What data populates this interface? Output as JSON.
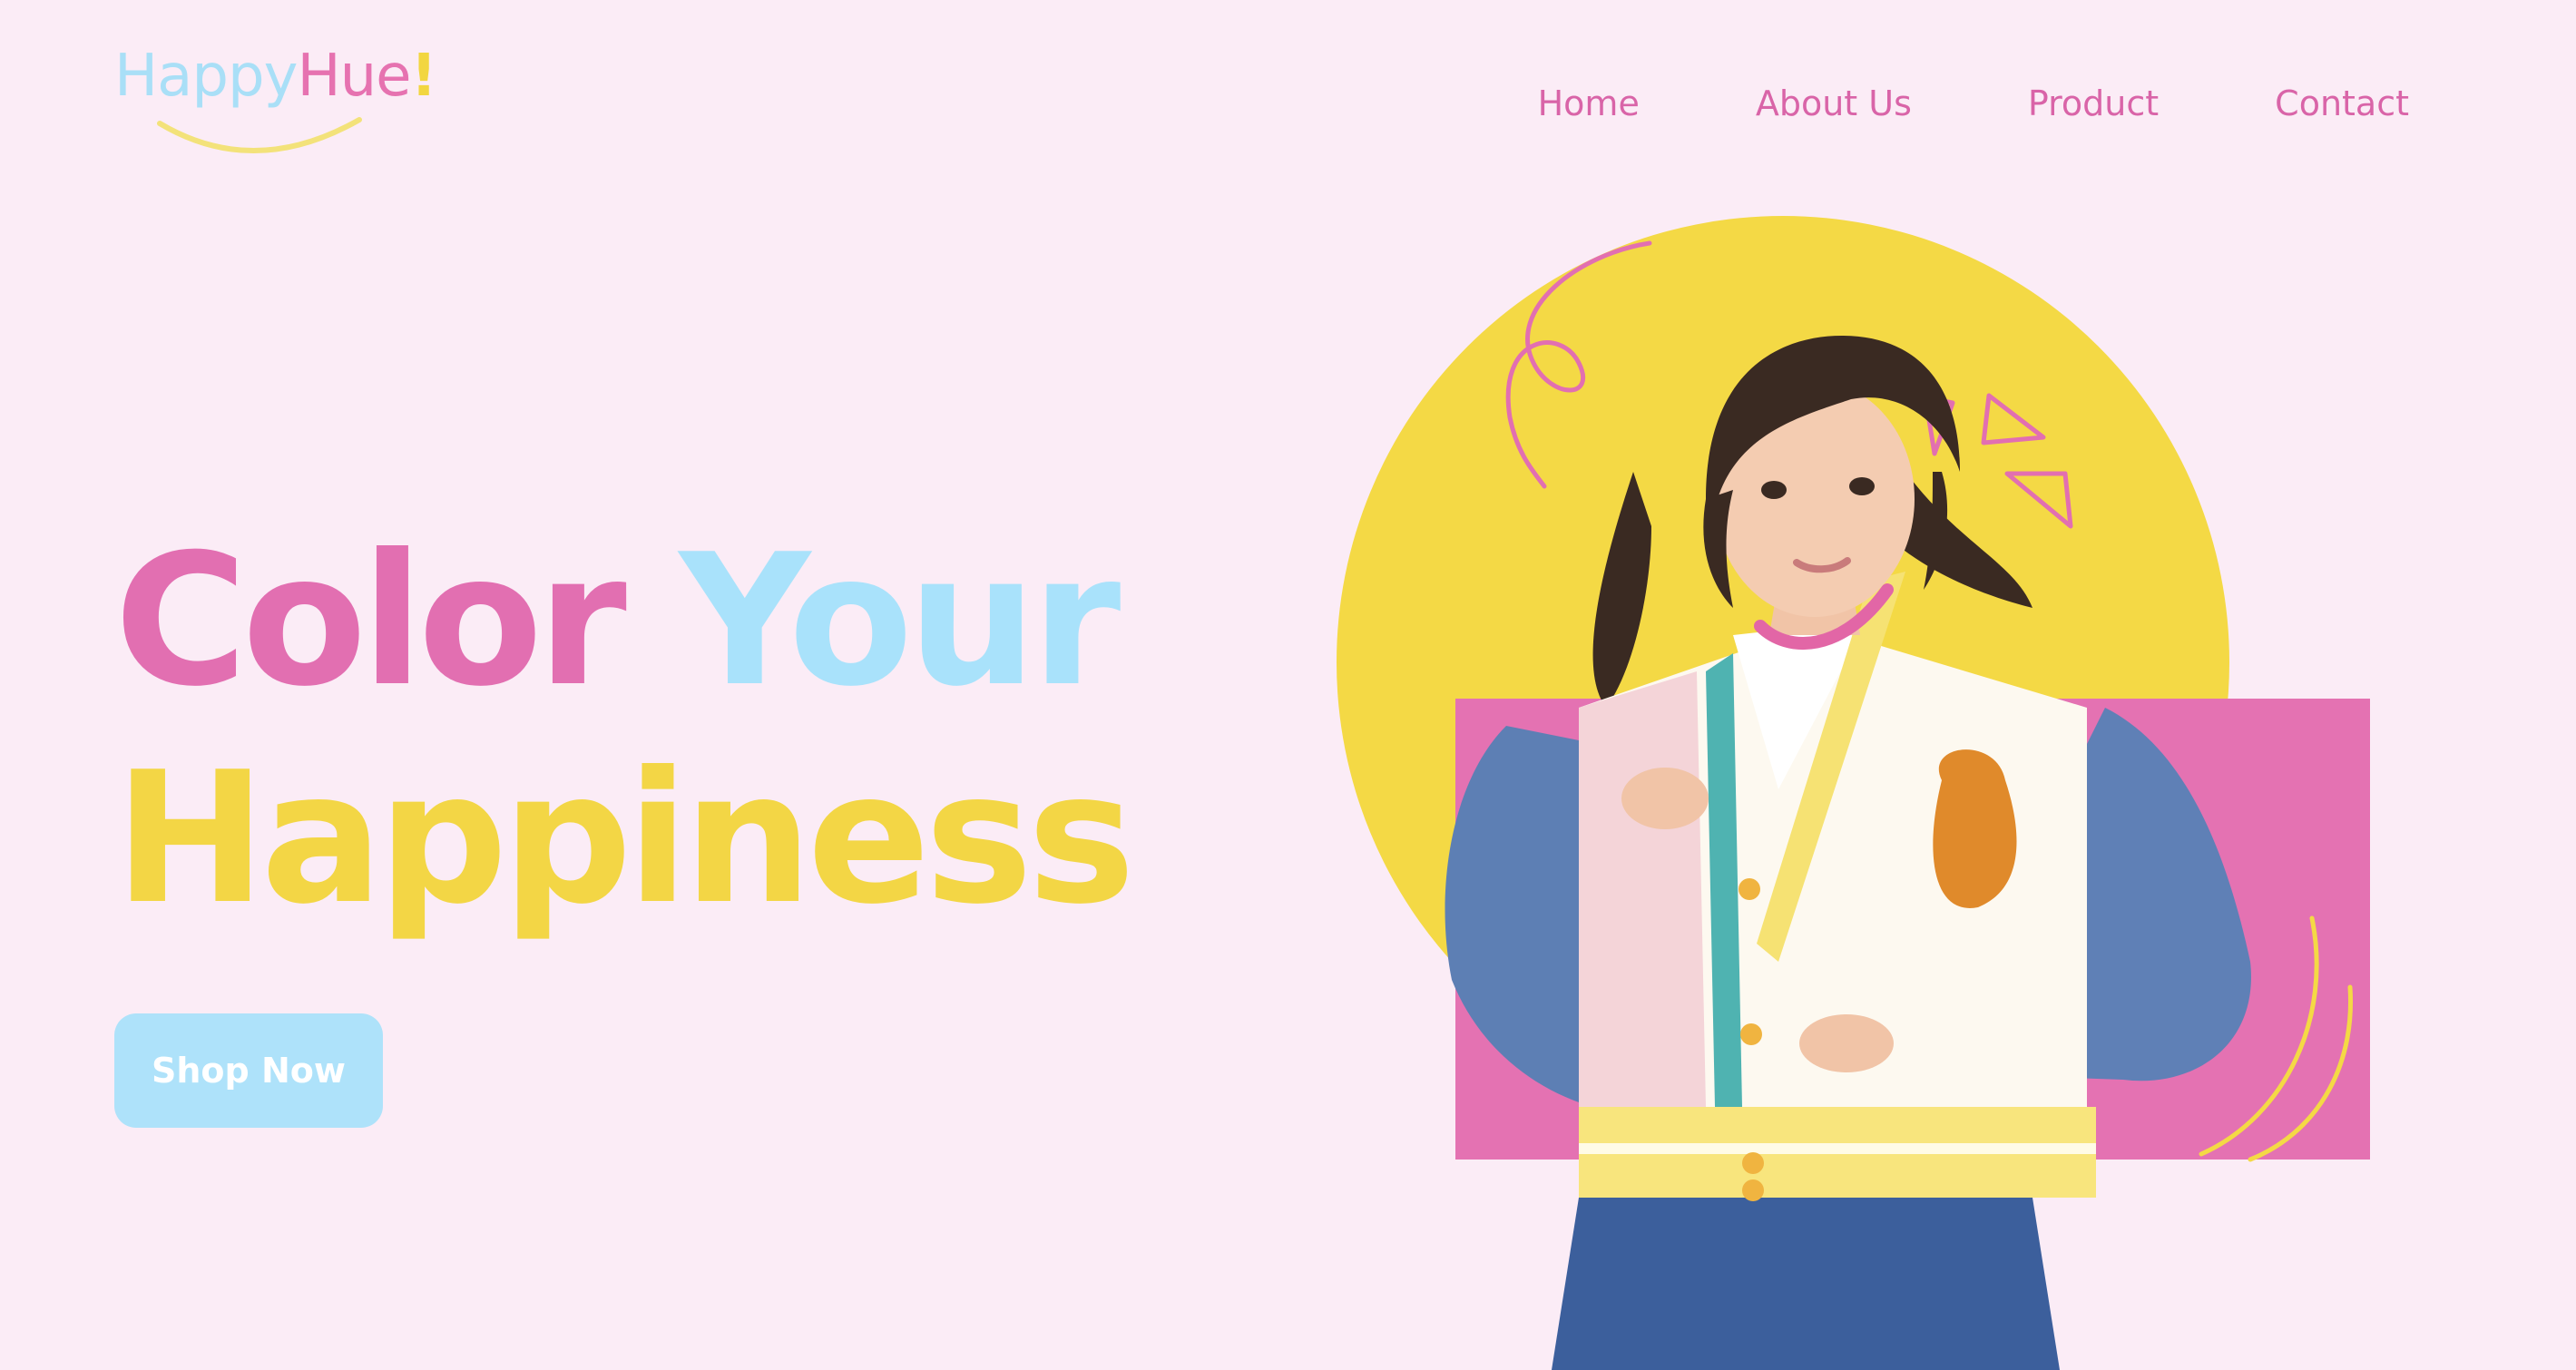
{
  "brand": {
    "part1": "Happy",
    "part2": "Hue",
    "part3": "!"
  },
  "nav": {
    "items": [
      {
        "label": "Home"
      },
      {
        "label": "About Us"
      },
      {
        "label": "Product"
      },
      {
        "label": "Contact"
      }
    ]
  },
  "hero": {
    "title_word1": "Color",
    "title_word2": "Your",
    "title_line2": "Happiness",
    "cta_label": "Shop Now"
  },
  "colors": {
    "background": "#fbecf6",
    "pink": "#e26fb1",
    "blue": "#a9e2fb",
    "yellow": "#f3d645"
  }
}
